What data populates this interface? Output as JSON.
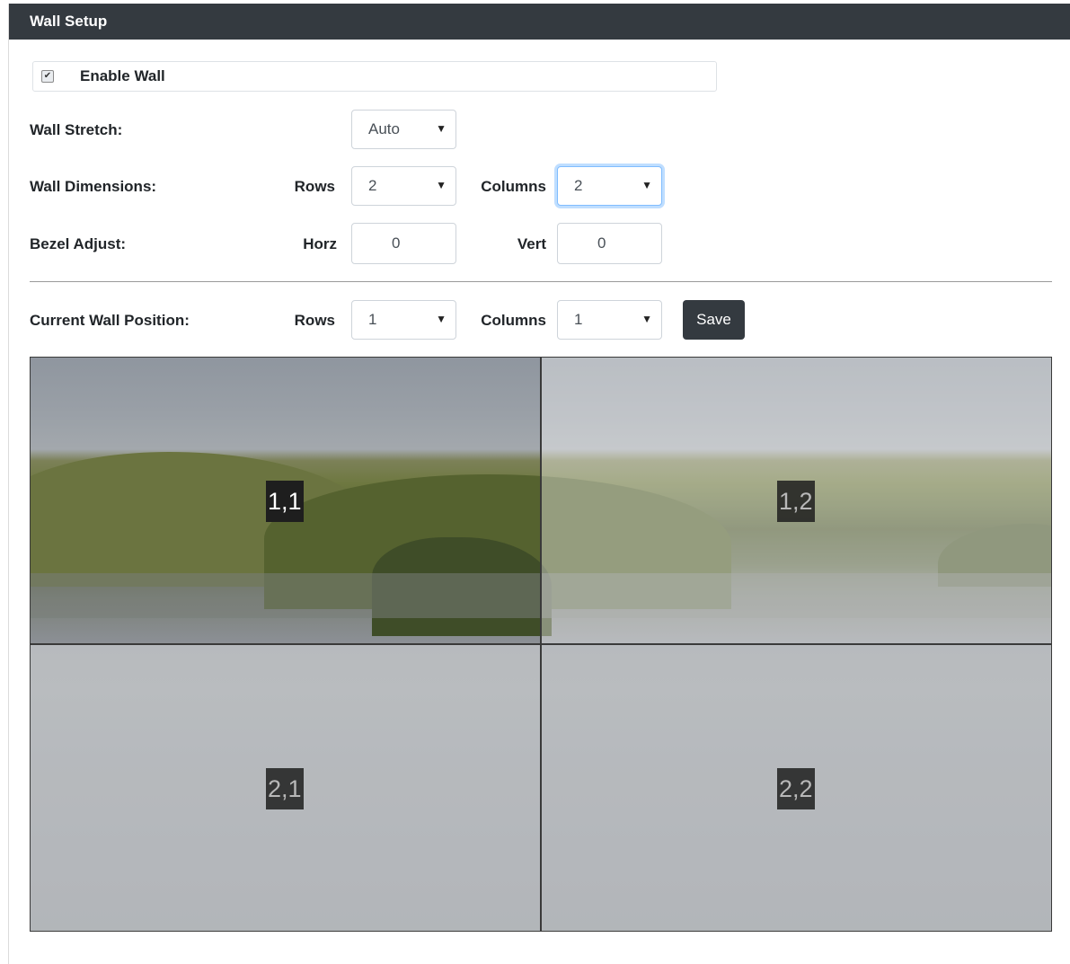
{
  "header": {
    "title": "Wall Setup"
  },
  "enable_wall": {
    "label": "Enable Wall",
    "checked": true,
    "check_glyph": "✔"
  },
  "wall_stretch": {
    "label": "Wall Stretch:",
    "value": "Auto"
  },
  "wall_dimensions": {
    "label": "Wall Dimensions:",
    "rows_label": "Rows",
    "rows_value": "2",
    "columns_label": "Columns",
    "columns_value": "2"
  },
  "bezel_adjust": {
    "label": "Bezel Adjust:",
    "horz_label": "Horz",
    "horz_value": "0",
    "vert_label": "Vert",
    "vert_value": "0"
  },
  "current_position": {
    "label": "Current Wall Position:",
    "rows_label": "Rows",
    "rows_value": "1",
    "columns_label": "Columns",
    "columns_value": "1",
    "save_label": "Save"
  },
  "dropdown_arrow": "▼",
  "wall_preview": {
    "tiles": [
      {
        "label": "1,1",
        "active": true
      },
      {
        "label": "1,2",
        "active": false
      },
      {
        "label": "2,1",
        "active": false
      },
      {
        "label": "2,2",
        "active": false
      }
    ]
  },
  "colors": {
    "header_bg": "#343a40",
    "button_bg": "#343a40",
    "focus_border": "#80bdff"
  }
}
